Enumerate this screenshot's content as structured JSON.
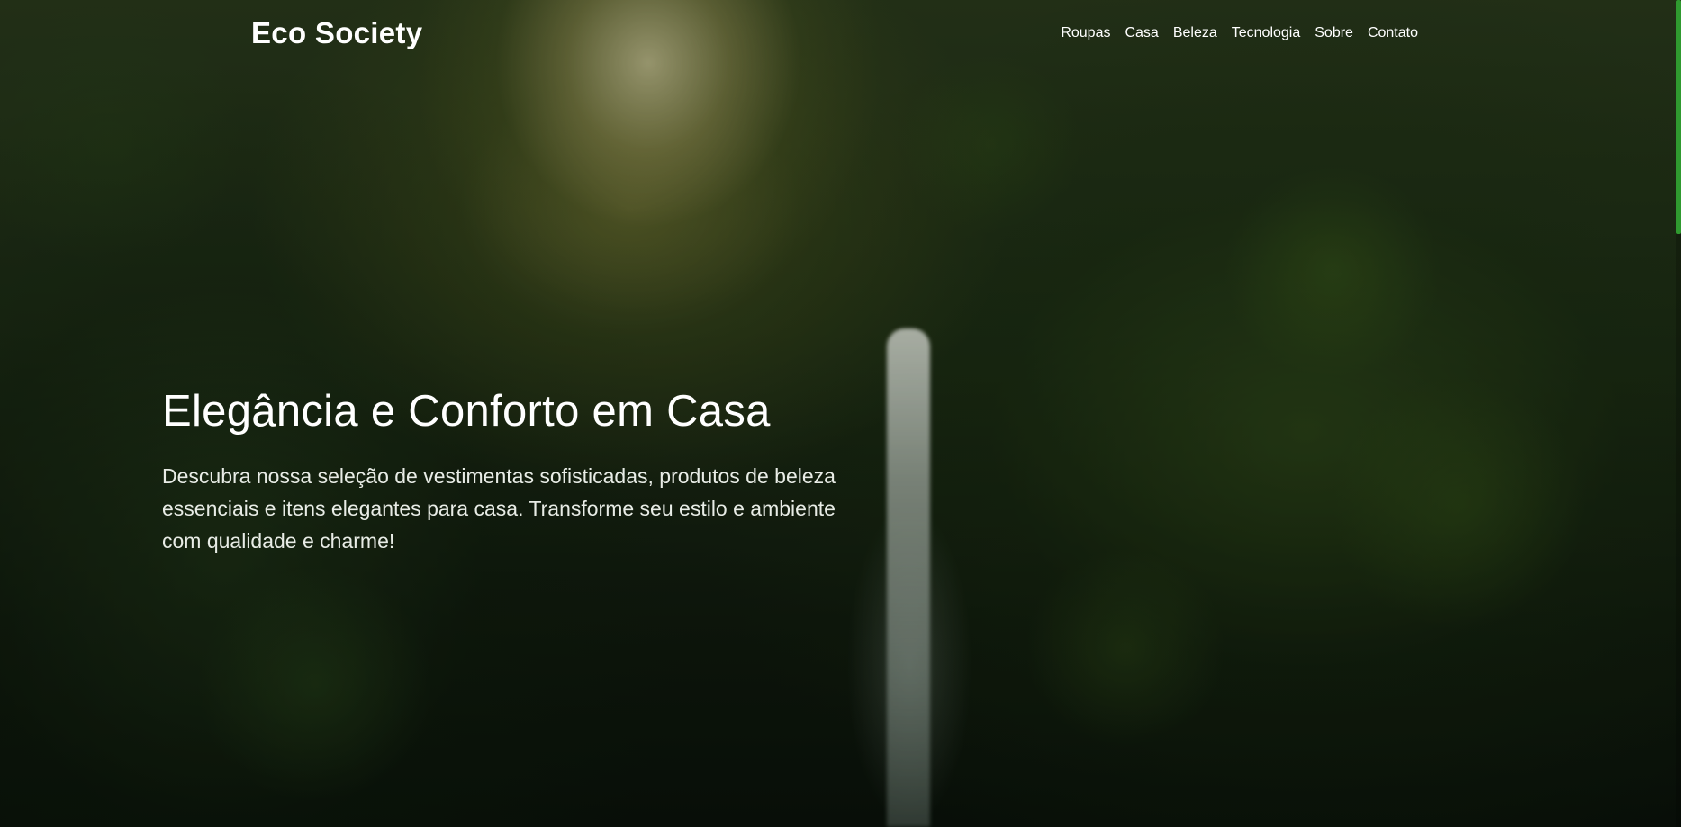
{
  "header": {
    "logo": "Eco Society",
    "nav": [
      {
        "label": "Roupas"
      },
      {
        "label": "Casa"
      },
      {
        "label": "Beleza"
      },
      {
        "label": "Tecnologia"
      },
      {
        "label": "Sobre"
      },
      {
        "label": "Contato"
      }
    ]
  },
  "hero": {
    "title": "Elegância e Conforto em Casa",
    "text": "Descubra nossa seleção de vestimentas sofisticadas, produtos de beleza essenciais e itens elegantes para casa. Transforme seu estilo e ambiente com qualidade e charme!"
  },
  "colors": {
    "scroll_thumb": "#2f9a2f",
    "text": "#ffffff"
  }
}
